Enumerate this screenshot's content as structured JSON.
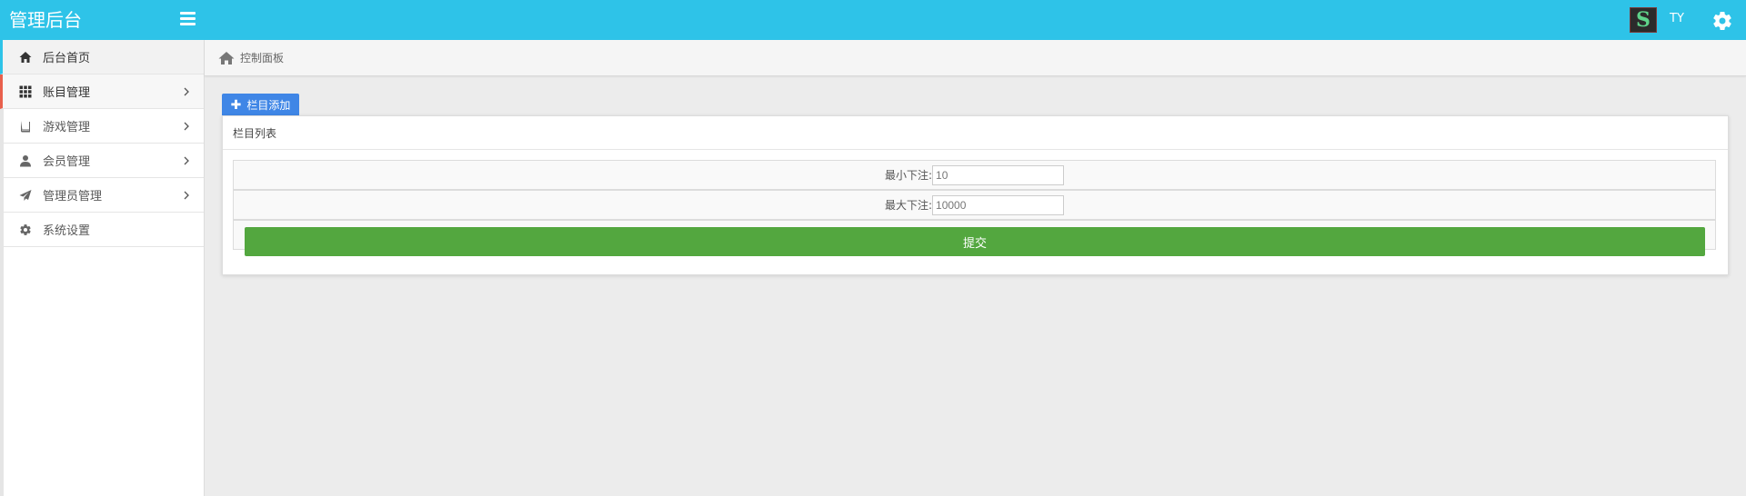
{
  "header": {
    "brand": "管理后台",
    "username": "TY",
    "avatar_letter": "S"
  },
  "colors": {
    "navbar": "#2ec3e8",
    "primary_button": "#3f86e6",
    "submit_button": "#53a73f",
    "active_indicator": "#2ec3e8",
    "open_indicator": "#e8604c"
  },
  "sidebar": {
    "items": [
      {
        "label": "后台首页",
        "icon": "home-icon",
        "state": "active",
        "has_arrow": false
      },
      {
        "label": "账目管理",
        "icon": "grid-icon",
        "state": "open",
        "has_arrow": true
      },
      {
        "label": "游戏管理",
        "icon": "book-icon",
        "state": "normal",
        "has_arrow": true
      },
      {
        "label": "会员管理",
        "icon": "user-icon",
        "state": "normal",
        "has_arrow": true
      },
      {
        "label": "管理员管理",
        "icon": "send-icon",
        "state": "normal",
        "has_arrow": true
      },
      {
        "label": "系统设置",
        "icon": "cog-icon",
        "state": "normal",
        "has_arrow": false
      }
    ]
  },
  "breadcrumb": {
    "text": "控制面板"
  },
  "main": {
    "add_button": "栏目添加",
    "panel_title": "栏目列表",
    "fields": {
      "min_bet_label": "最小下注:",
      "min_bet_value": "10",
      "max_bet_label": "最大下注:",
      "max_bet_value": "10000"
    },
    "submit_label": "提交"
  }
}
